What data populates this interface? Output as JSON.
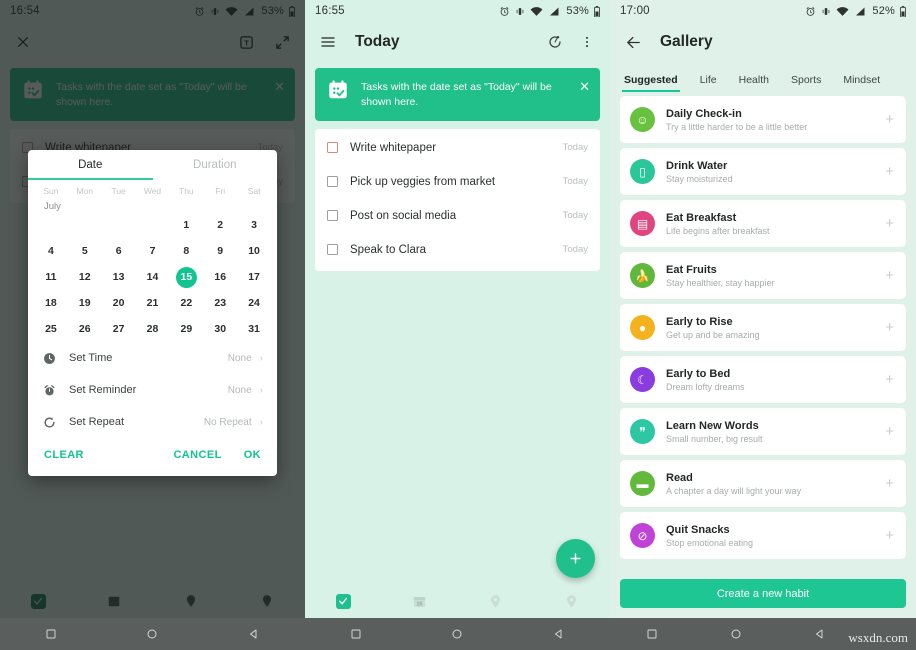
{
  "panel1": {
    "status": {
      "time": "16:54",
      "battery": "53%"
    },
    "appbar": {
      "close": "✕",
      "text_icon": "T",
      "expand_icon": "expand"
    },
    "banner": {
      "text": "Tasks with the date set as \"Today\" will be shown here.",
      "close": "✕"
    },
    "tasks": [
      {
        "name": "Write whitepaper",
        "due": "Today",
        "checkbox": "red"
      },
      {
        "name": "",
        "due": "day",
        "checkbox": "gray"
      }
    ],
    "dialog": {
      "tabs": [
        {
          "label": "Date",
          "active": true
        },
        {
          "label": "Duration",
          "active": false
        }
      ],
      "weekdays": [
        "Sun",
        "Mon",
        "Tue",
        "Wed",
        "Thu",
        "Fri",
        "Sat"
      ],
      "month": "July",
      "selected_day": 15,
      "first_day_index": 4,
      "days_in_month": 31,
      "options": [
        {
          "icon": "clock-icon",
          "label": "Set Time",
          "value": "None"
        },
        {
          "icon": "alarm-icon",
          "label": "Set Reminder",
          "value": "None"
        },
        {
          "icon": "repeat-icon",
          "label": "Set Repeat",
          "value": "No Repeat"
        }
      ],
      "actions": {
        "clear": "CLEAR",
        "cancel": "CANCEL",
        "ok": "OK"
      }
    }
  },
  "panel2": {
    "status": {
      "time": "16:55",
      "battery": "53%"
    },
    "appbar": {
      "title": "Today",
      "menu_icon": "hamburger-icon",
      "timer_icon": "timer-icon",
      "overflow_icon": "more-vertical-icon"
    },
    "banner": {
      "text": "Tasks with the date set as \"Today\" will be shown here.",
      "close": "✕"
    },
    "tasks": [
      {
        "name": "Write whitepaper",
        "due": "Today",
        "checkbox": "red"
      },
      {
        "name": "Pick up veggies from market",
        "due": "Today",
        "checkbox": "gray"
      },
      {
        "name": "Post on social media",
        "due": "Today",
        "checkbox": "gray"
      },
      {
        "name": "Speak to Clara",
        "due": "Today",
        "checkbox": "gray"
      }
    ],
    "fab": {
      "label": "+"
    },
    "tabbar": [
      {
        "icon": "check-icon",
        "active": true
      },
      {
        "icon": "calendar-icon",
        "active": false,
        "badge": "15"
      },
      {
        "icon": "pin-clock-icon",
        "active": false
      },
      {
        "icon": "pin-circle-icon",
        "active": false
      }
    ]
  },
  "panel3": {
    "status": {
      "time": "17:00",
      "battery": "52%"
    },
    "appbar": {
      "title": "Gallery",
      "back_icon": "arrow-left-icon"
    },
    "tabs": [
      {
        "label": "Suggested",
        "active": true
      },
      {
        "label": "Life",
        "active": false
      },
      {
        "label": "Health",
        "active": false
      },
      {
        "label": "Sports",
        "active": false
      },
      {
        "label": "Mindset",
        "active": false
      }
    ],
    "habits": [
      {
        "title": "Daily Check-in",
        "subtitle": "Try a little harder to be a little better",
        "color": "#68c23f",
        "glyph": "☺",
        "add": "+"
      },
      {
        "title": "Drink Water",
        "subtitle": "Stay moisturized",
        "color": "#2bc79a",
        "glyph": "▯",
        "add": "+"
      },
      {
        "title": "Eat Breakfast",
        "subtitle": "Life begins after breakfast",
        "color": "#e0457f",
        "glyph": "▤",
        "add": "+"
      },
      {
        "title": "Eat Fruits",
        "subtitle": "Stay healthier, stay happier",
        "color": "#5fb83b",
        "glyph": "🍌",
        "add": "+"
      },
      {
        "title": "Early to Rise",
        "subtitle": "Get up and be amazing",
        "color": "#f4b31e",
        "glyph": "●",
        "add": "+"
      },
      {
        "title": "Early to Bed",
        "subtitle": "Dream lofty dreams",
        "color": "#8b3ce0",
        "glyph": "☾",
        "add": "+"
      },
      {
        "title": "Learn New Words",
        "subtitle": "Small number, big result",
        "color": "#2ec7a4",
        "glyph": "❞",
        "add": "+"
      },
      {
        "title": "Read",
        "subtitle": "A chapter a day will light your way",
        "color": "#63b93c",
        "glyph": "▬",
        "add": "+"
      },
      {
        "title": "Quit Snacks",
        "subtitle": "Stop emotional eating",
        "color": "#c043d8",
        "glyph": "⊘",
        "add": "+"
      }
    ],
    "cta": "Create a new habit",
    "watermark": "wsxdn.com"
  },
  "navbar": {
    "recent": "square",
    "home": "circle",
    "back": "triangle"
  },
  "colors": {
    "accent": "#1fc08b",
    "banner": "#21c08a",
    "selected_day": "#13c493",
    "panel2_bg": "#d9f2e7",
    "panel3_bg": "#dff1e9"
  }
}
